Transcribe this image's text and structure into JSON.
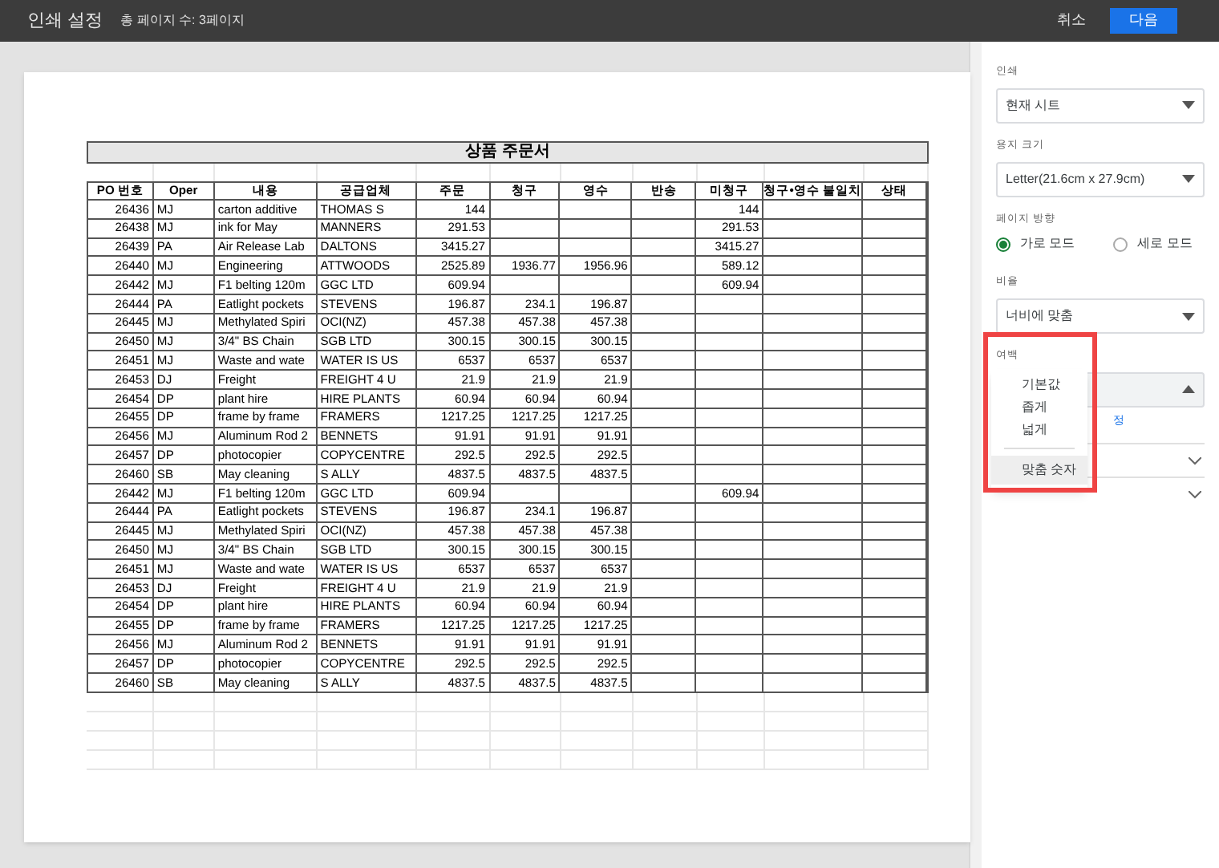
{
  "header": {
    "title": "인쇄 설정",
    "page_count": "총 페이지 수: 3페이지",
    "cancel": "취소",
    "next": "다음"
  },
  "sheet": {
    "title": "상품 주문서",
    "columns": [
      "PO 번호",
      "Oper",
      "내용",
      "공급업체",
      "주문",
      "청구",
      "영수",
      "반송",
      "미청구",
      "청구•영수 불일치",
      "상태"
    ],
    "rows": [
      {
        "po": "26436",
        "oper": "MJ",
        "item": "carton additive",
        "supplier": "THOMAS S",
        "order": "144",
        "unbilled": "144"
      },
      {
        "po": "26438",
        "oper": "MJ",
        "item": "ink for May",
        "supplier": "MANNERS",
        "order": "291.53",
        "unbilled": "291.53"
      },
      {
        "po": "26439",
        "oper": "PA",
        "item": "Air Release Lab",
        "supplier": "DALTONS",
        "order": "3415.27",
        "unbilled": "3415.27"
      },
      {
        "po": "26440",
        "oper": "MJ",
        "item": "Engineering",
        "supplier": "ATTWOODS",
        "order": "2525.89",
        "billed": "1936.77",
        "receipt": "1956.96",
        "unbilled": "589.12"
      },
      {
        "po": "26442",
        "oper": "MJ",
        "item": "F1 belting 120m",
        "supplier": "GGC LTD",
        "order": "609.94",
        "unbilled": "609.94"
      },
      {
        "po": "26444",
        "oper": "PA",
        "item": "Eatlight pockets",
        "supplier": "STEVENS",
        "order": "196.87",
        "billed": "234.1",
        "receipt": "196.87"
      },
      {
        "po": "26445",
        "oper": "MJ",
        "item": "Methylated Spiri",
        "supplier": "OCI(NZ)",
        "order": "457.38",
        "billed": "457.38",
        "receipt": "457.38"
      },
      {
        "po": "26450",
        "oper": "MJ",
        "item": "3/4\" BS Chain",
        "supplier": "SGB LTD",
        "order": "300.15",
        "billed": "300.15",
        "receipt": "300.15"
      },
      {
        "po": "26451",
        "oper": "MJ",
        "item": "Waste and wate",
        "supplier": "WATER IS US",
        "order": "6537",
        "billed": "6537",
        "receipt": "6537"
      },
      {
        "po": "26453",
        "oper": "DJ",
        "item": "Freight",
        "supplier": "FREIGHT 4 U",
        "order": "21.9",
        "billed": "21.9",
        "receipt": "21.9"
      },
      {
        "po": "26454",
        "oper": "DP",
        "item": "plant hire",
        "supplier": "HIRE PLANTS",
        "order": "60.94",
        "billed": "60.94",
        "receipt": "60.94"
      },
      {
        "po": "26455",
        "oper": "DP",
        "item": "frame by frame",
        "supplier": "FRAMERS",
        "order": "1217.25",
        "billed": "1217.25",
        "receipt": "1217.25"
      },
      {
        "po": "26456",
        "oper": "MJ",
        "item": "Aluminum Rod 2",
        "supplier": "BENNETS",
        "order": "91.91",
        "billed": "91.91",
        "receipt": "91.91"
      },
      {
        "po": "26457",
        "oper": "DP",
        "item": "photocopier",
        "supplier": "COPYCENTRE",
        "order": "292.5",
        "billed": "292.5",
        "receipt": "292.5"
      },
      {
        "po": "26460",
        "oper": "SB",
        "item": "May cleaning",
        "supplier": "S ALLY",
        "order": "4837.5",
        "billed": "4837.5",
        "receipt": "4837.5"
      },
      {
        "po": "26442",
        "oper": "MJ",
        "item": "F1 belting 120m",
        "supplier": "GGC LTD",
        "order": "609.94",
        "unbilled": "609.94"
      },
      {
        "po": "26444",
        "oper": "PA",
        "item": "Eatlight pockets",
        "supplier": "STEVENS",
        "order": "196.87",
        "billed": "234.1",
        "receipt": "196.87"
      },
      {
        "po": "26445",
        "oper": "MJ",
        "item": "Methylated Spiri",
        "supplier": "OCI(NZ)",
        "order": "457.38",
        "billed": "457.38",
        "receipt": "457.38"
      },
      {
        "po": "26450",
        "oper": "MJ",
        "item": "3/4\" BS Chain",
        "supplier": "SGB LTD",
        "order": "300.15",
        "billed": "300.15",
        "receipt": "300.15"
      },
      {
        "po": "26451",
        "oper": "MJ",
        "item": "Waste and wate",
        "supplier": "WATER IS US",
        "order": "6537",
        "billed": "6537",
        "receipt": "6537"
      },
      {
        "po": "26453",
        "oper": "DJ",
        "item": "Freight",
        "supplier": "FREIGHT 4 U",
        "order": "21.9",
        "billed": "21.9",
        "receipt": "21.9"
      },
      {
        "po": "26454",
        "oper": "DP",
        "item": "plant hire",
        "supplier": "HIRE PLANTS",
        "order": "60.94",
        "billed": "60.94",
        "receipt": "60.94"
      },
      {
        "po": "26455",
        "oper": "DP",
        "item": "frame by frame",
        "supplier": "FRAMERS",
        "order": "1217.25",
        "billed": "1217.25",
        "receipt": "1217.25"
      },
      {
        "po": "26456",
        "oper": "MJ",
        "item": "Aluminum Rod 2",
        "supplier": "BENNETS",
        "order": "91.91",
        "billed": "91.91",
        "receipt": "91.91"
      },
      {
        "po": "26457",
        "oper": "DP",
        "item": "photocopier",
        "supplier": "COPYCENTRE",
        "order": "292.5",
        "billed": "292.5",
        "receipt": "292.5"
      },
      {
        "po": "26460",
        "oper": "SB",
        "item": "May cleaning",
        "supplier": "S ALLY",
        "order": "4837.5",
        "billed": "4837.5",
        "receipt": "4837.5"
      }
    ]
  },
  "settings": {
    "print": {
      "label": "인쇄",
      "value": "현재 시트"
    },
    "paper_size": {
      "label": "용지 크기",
      "value": "Letter(21.6cm x 27.9cm)"
    },
    "orientation": {
      "label": "페이지 방향",
      "options": [
        {
          "label": "가로 모드",
          "selected": true
        },
        {
          "label": "세로 모드",
          "selected": false
        }
      ]
    },
    "scale": {
      "label": "비율",
      "value": "너비에 맞춤"
    },
    "margins": {
      "label": "여백",
      "expanded": true,
      "link": "정",
      "menu": [
        {
          "label": "기본값",
          "highlighted": false
        },
        {
          "label": "좁게",
          "highlighted": false
        },
        {
          "label": "넓게",
          "highlighted": false
        },
        {
          "label": "맞춤 숫자",
          "highlighted": true
        }
      ]
    },
    "sections": [
      {
        "expanded": false
      },
      {
        "expanded": false
      }
    ]
  }
}
